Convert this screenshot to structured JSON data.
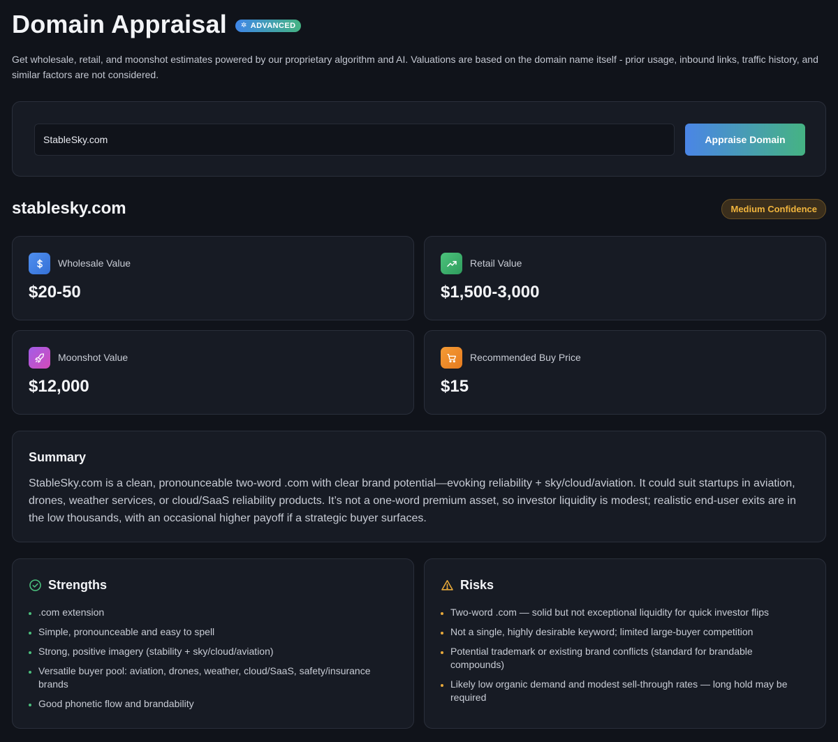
{
  "header": {
    "title": "Domain Appraisal",
    "badge": "ADVANCED",
    "subtitle": "Get wholesale, retail, and moonshot estimates powered by our proprietary algorithm and AI. Valuations are based on the domain name itself - prior usage, inbound links, traffic history, and similar factors are not considered."
  },
  "search": {
    "value": "StableSky.com",
    "button_label": "Appraise Domain"
  },
  "result": {
    "domain": "stablesky.com",
    "confidence": "Medium Confidence",
    "values": [
      {
        "label": "Wholesale Value",
        "value": "$20-50",
        "icon": "dollar-icon",
        "color": "#3d7fe6"
      },
      {
        "label": "Retail Value",
        "value": "$1,500-3,000",
        "icon": "trending-up-icon",
        "color": "#3fb36d"
      },
      {
        "label": "Moonshot Value",
        "value": "$12,000",
        "icon": "rocket-icon",
        "color": "#b255d8"
      },
      {
        "label": "Recommended Buy Price",
        "value": "$15",
        "icon": "cart-icon",
        "color": "#f0912c"
      }
    ],
    "summary": {
      "title": "Summary",
      "text": "StableSky.com is a clean, pronounceable two-word .com with clear brand potential—evoking reliability + sky/cloud/aviation. It could suit startups in aviation, drones, weather services, or cloud/SaaS reliability products. It’s not a one-word premium asset, so investor liquidity is modest; realistic end-user exits are in the low thousands, with an occasional higher payoff if a strategic buyer surfaces."
    },
    "strengths": {
      "title": "Strengths",
      "items": [
        ".com extension",
        "Simple, pronounceable and easy to spell",
        "Strong, positive imagery (stability + sky/cloud/aviation)",
        "Versatile buyer pool: aviation, drones, weather, cloud/SaaS, safety/insurance brands",
        "Good phonetic flow and brandability"
      ]
    },
    "risks": {
      "title": "Risks",
      "items": [
        "Two-word .com — solid but not exceptional liquidity for quick investor flips",
        "Not a single, highly desirable keyword; limited large-buyer competition",
        "Potential trademark or existing brand conflicts (standard for brandable compounds)",
        "Likely low organic demand and modest sell-through rates — long hold may be required"
      ]
    }
  }
}
